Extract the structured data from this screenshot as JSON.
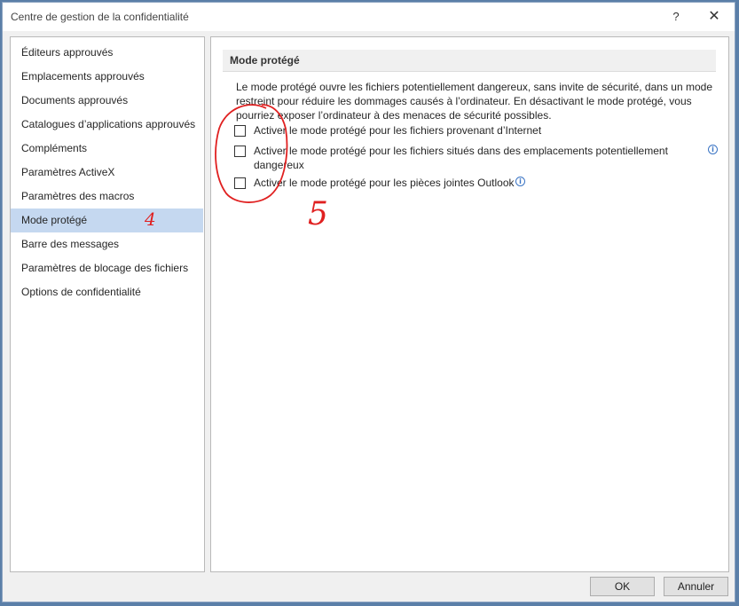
{
  "window": {
    "title": "Centre de gestion de la confidentialité",
    "help_label": "?",
    "close_label": "✕"
  },
  "sidebar": {
    "items": [
      {
        "label": "Éditeurs approuvés"
      },
      {
        "label": "Emplacements approuvés"
      },
      {
        "label": "Documents approuvés"
      },
      {
        "label": "Catalogues d’applications approuvés"
      },
      {
        "label": "Compléments"
      },
      {
        "label": "Paramètres ActiveX"
      },
      {
        "label": "Paramètres des macros"
      },
      {
        "label": "Mode protégé"
      },
      {
        "label": "Barre des messages"
      },
      {
        "label": "Paramètres de blocage des fichiers"
      },
      {
        "label": "Options de confidentialité"
      }
    ],
    "selected": "Mode protégé"
  },
  "main": {
    "section_title": "Mode protégé",
    "description": "Le mode protégé ouvre les fichiers potentiellement dangereux, sans invite de sécurité, dans un mode restreint pour réduire les dommages causés à l’ordinateur. En désactivant le mode protégé, vous pourriez exposer l’ordinateur à des menaces de sécurité possibles.",
    "options": [
      {
        "label": "Activer le mode protégé pour les fichiers provenant d’Internet",
        "checked": false
      },
      {
        "label": "Activer le mode protégé pour les fichiers situés dans des emplacements potentiellement dangereux",
        "checked": false
      },
      {
        "label": "Activer le mode protégé pour les pièces jointes Outlook",
        "checked": false
      }
    ],
    "info_icon": "i"
  },
  "footer": {
    "ok_label": "OK",
    "cancel_label": "Annuler"
  },
  "annotations": {
    "step_selected": "4",
    "step_options": "5",
    "color": "#e02020"
  }
}
